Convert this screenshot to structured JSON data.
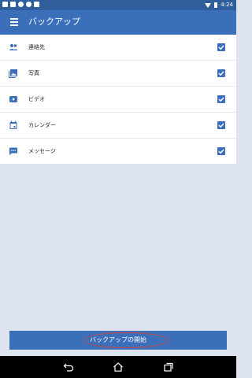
{
  "status_bar": {
    "time": "4:24"
  },
  "app_bar": {
    "title": "バックアップ"
  },
  "items": [
    {
      "label": "連絡先",
      "icon": "contacts-icon",
      "checked": true
    },
    {
      "label": "写真",
      "icon": "photos-icon",
      "checked": true
    },
    {
      "label": "ビデオ",
      "icon": "video-icon",
      "checked": true
    },
    {
      "label": "カレンダー",
      "icon": "calendar-icon",
      "checked": true
    },
    {
      "label": "メッセージ",
      "icon": "message-icon",
      "checked": true
    }
  ],
  "start_button": {
    "label": "バックアップの開始"
  },
  "colors": {
    "primary": "#3b6fba",
    "status_bar": "#2f5e9c",
    "background": "#dde3ef",
    "highlight": "#d6453f"
  },
  "nav": {
    "icons": [
      "back-icon",
      "home-icon",
      "recent-apps-icon"
    ]
  }
}
